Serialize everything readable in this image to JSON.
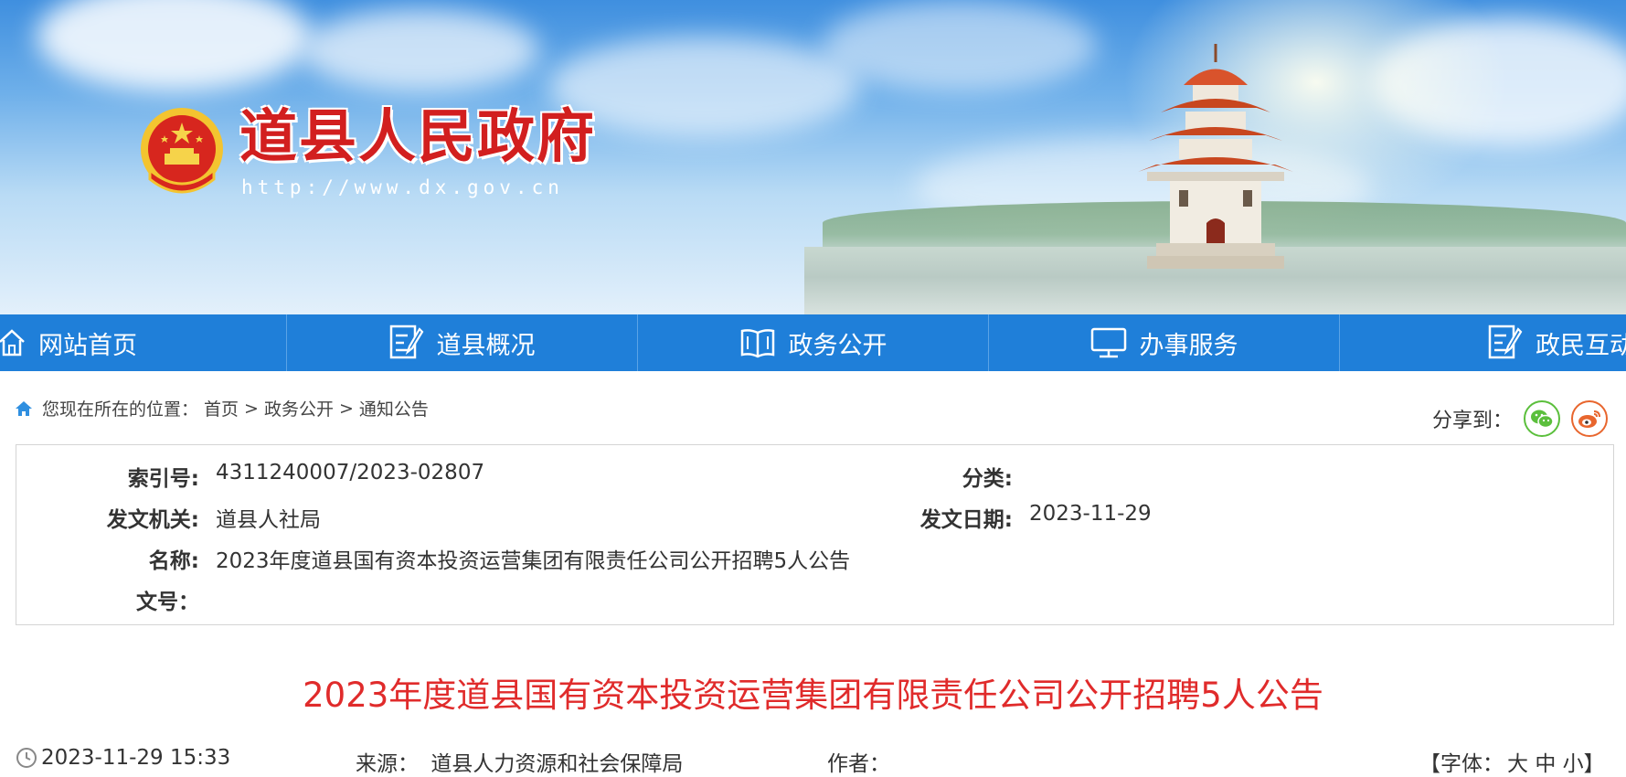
{
  "banner": {
    "title": "道县人民政府",
    "url": "http://www.dx.gov.cn"
  },
  "nav": {
    "items": [
      {
        "label": "网站首页",
        "icon": "home-icon"
      },
      {
        "label": "道县概况",
        "icon": "document-edit-icon"
      },
      {
        "label": "政务公开",
        "icon": "open-book-icon"
      },
      {
        "label": "办事服务",
        "icon": "monitor-icon"
      },
      {
        "label": "政民互动",
        "icon": "document-edit-icon"
      }
    ]
  },
  "breadcrumb": {
    "prefix": "您现在所在的位置：",
    "items": [
      "首页",
      "政务公开",
      "通知公告"
    ],
    "separator": ">"
  },
  "share": {
    "label": "分享到：",
    "targets": [
      "wechat-icon",
      "weibo-icon"
    ]
  },
  "info": {
    "index_label": "索引号:",
    "index_value": "4311240007/2023-02807",
    "category_label": "分类:",
    "category_value": "",
    "issuer_label": "发文机关:",
    "issuer_value": "道县人社局",
    "date_label": "发文日期:",
    "date_value": "2023-11-29",
    "name_label": "名称:",
    "name_value": "2023年度道县国有资本投资运营集团有限责任公司公开招聘5人公告",
    "docno_label": "文号：",
    "docno_value": ""
  },
  "article": {
    "title": "2023年度道县国有资本投资运营集团有限责任公司公开招聘5人公告",
    "datetime": "2023-11-29 15:33",
    "source_label": "来源：",
    "source_value": "道县人力资源和社会保障局",
    "author_label": "作者：",
    "author_value": "",
    "font_open": "【字体：",
    "font_large": "大",
    "font_medium": "中",
    "font_small": "小",
    "font_close": "】"
  },
  "colors": {
    "nav_bg": "#1f7fd9",
    "title_red": "#e02b2b",
    "brand_red": "#d21f1f"
  }
}
